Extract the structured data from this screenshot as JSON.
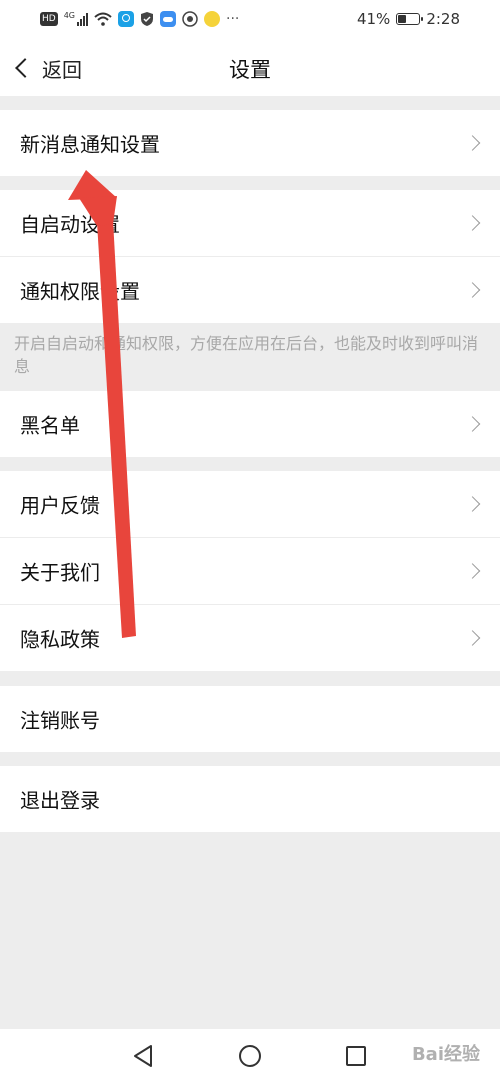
{
  "status_bar": {
    "hd_badge": "HD",
    "network": "4G",
    "battery_percent": "41%",
    "battery_level": 0.41,
    "time": "2:28",
    "icons": [
      "hd-icon",
      "signal-icon",
      "wifi-icon",
      "search-app-icon",
      "shield-icon",
      "cloud-icon",
      "chrome-icon",
      "emoji-app-icon",
      "more-dots-icon"
    ]
  },
  "header": {
    "back_label": "返回",
    "title": "设置"
  },
  "settings": {
    "new_message_notification": "新消息通知设置",
    "auto_start": "自启动设置",
    "notification_permission": "通知权限设置",
    "hint": "开启自启动和通知权限，方便在应用在后台，也能及时收到呼叫消息",
    "blacklist": "黑名单",
    "feedback": "用户反馈",
    "about_us": "关于我们",
    "privacy_policy": "隐私政策",
    "cancel_account": "注销账号",
    "logout": "退出登录"
  },
  "navbar": {
    "buttons": [
      "back-triangle-icon",
      "home-circle-icon",
      "recents-square-icon"
    ]
  },
  "watermark": "Bai经验",
  "colors": {
    "background": "#ededed",
    "row_background": "#ffffff",
    "hint_text": "#a8a8a8",
    "annotation_arrow": "#e8453c"
  }
}
